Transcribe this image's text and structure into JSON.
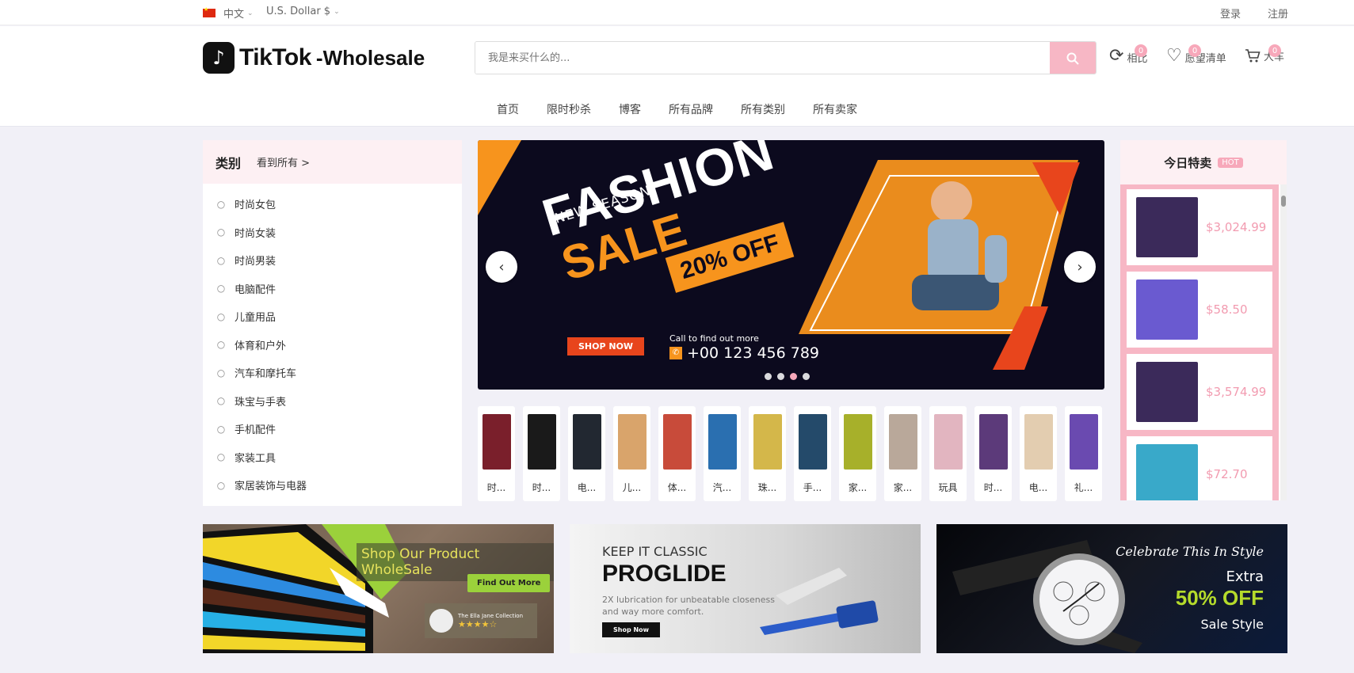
{
  "topbar": {
    "language": "中文",
    "currency": "U.S. Dollar $",
    "login": "登录",
    "register": "注册"
  },
  "header": {
    "logo_main": "TikTok",
    "logo_suffix": "-Wholesale",
    "search_placeholder": "我是来买什么的...",
    "compare": {
      "label": "相比",
      "count": "0"
    },
    "wishlist": {
      "label": "愿望清单",
      "count": "0"
    },
    "cart": {
      "label": "大车",
      "count": "0"
    }
  },
  "nav": [
    "首页",
    "限时秒杀",
    "博客",
    "所有品牌",
    "所有类别",
    "所有卖家"
  ],
  "categories": {
    "title": "类别",
    "see_all": "看到所有 >",
    "items": [
      {
        "label": "时尚女包",
        "icon": "handbag-icon"
      },
      {
        "label": "时尚女装",
        "icon": "dress-icon"
      },
      {
        "label": "时尚男装",
        "icon": "shirt-icon"
      },
      {
        "label": "电脑配件",
        "icon": "computer-icon"
      },
      {
        "label": "儿童用品",
        "icon": "baby-icon"
      },
      {
        "label": "体育和户外",
        "icon": "sports-icon"
      },
      {
        "label": "汽车和摩托车",
        "icon": "car-icon"
      },
      {
        "label": "珠宝与手表",
        "icon": "watch-icon"
      },
      {
        "label": "手机配件",
        "icon": "phone-icon"
      },
      {
        "label": "家装工具",
        "icon": "tools-icon"
      },
      {
        "label": "家居装饰与电器",
        "icon": "home-icon"
      }
    ]
  },
  "slider": {
    "kicker": "NEW SEASON",
    "title1": "FASHION",
    "title2": "SALE",
    "discount": "20% OFF",
    "cta": "SHOP NOW",
    "call_text": "Call to find out more",
    "phone": "+00 123 456 789",
    "prev": "‹",
    "next": "›",
    "slide_count": 4,
    "active_slide": 3
  },
  "thumbs": [
    {
      "label": "时...",
      "color": "#7a1f2b"
    },
    {
      "label": "时...",
      "color": "#1a1a1a"
    },
    {
      "label": "电...",
      "color": "#222831"
    },
    {
      "label": "儿...",
      "color": "#d9a46b"
    },
    {
      "label": "体...",
      "color": "#c84b3a"
    },
    {
      "label": "汽...",
      "color": "#2a6fb0"
    },
    {
      "label": "珠...",
      "color": "#d4b74a"
    },
    {
      "label": "手...",
      "color": "#244a6a"
    },
    {
      "label": "家...",
      "color": "#a7b02a"
    },
    {
      "label": "家...",
      "color": "#b9a89a"
    },
    {
      "label": "玩具",
      "color": "#e2b5c0"
    },
    {
      "label": "时...",
      "color": "#5c3a7a"
    },
    {
      "label": "电...",
      "color": "#e3cdb0"
    },
    {
      "label": "礼...",
      "color": "#6a4ab0"
    }
  ],
  "today": {
    "title": "今日特卖",
    "badge": "HOT",
    "deals": [
      {
        "price": "$3,024.99",
        "color": "#3b2a5a"
      },
      {
        "price": "$58.50",
        "color": "#6a5ad0"
      },
      {
        "price": "$3,574.99",
        "color": "#3b2a5a"
      },
      {
        "price": "$72.70",
        "color": "#39a9c9"
      }
    ]
  },
  "banners": {
    "b1": {
      "title": "Shop Our Product WholeSale",
      "cta": "Find Out More",
      "brand": "The Ella Jane Collection",
      "stars": "★★★★☆"
    },
    "b2": {
      "kicker": "KEEP IT CLASSIC",
      "title": "PROGLIDE",
      "desc1": "2X lubrication for unbeatable closeness",
      "desc2": "and way more comfort.",
      "cta": "Shop Now"
    },
    "b3": {
      "script": "Celebrate This In Style",
      "extra": "Extra",
      "offer": "50% OFF",
      "sub": "Sale Style"
    }
  }
}
